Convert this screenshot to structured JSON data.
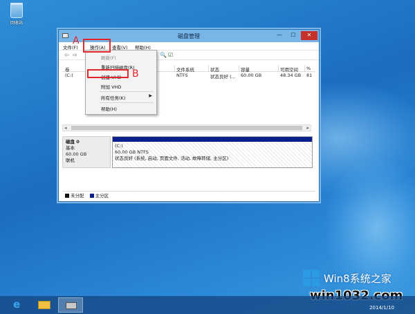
{
  "desktop": {
    "recycle_bin_label": "回收站"
  },
  "window": {
    "title": "磁盘管理",
    "controls": {
      "minimize": "—",
      "maximize": "☐",
      "close": "✕"
    }
  },
  "menubar": {
    "file": "文件(F)",
    "action": "操作(A)",
    "view": "查看(V)",
    "help": "帮助(H)"
  },
  "toolbar": {
    "back": "⇦",
    "forward": "⇨",
    "zoom": "🔍",
    "properties": "☑"
  },
  "volume_list": {
    "columns": {
      "volume": "卷",
      "filesystem": "文件系统",
      "status": "状态",
      "capacity": "容量",
      "free": "可用空间",
      "pct": "%"
    },
    "rows": [
      {
        "volume": "(C:)",
        "filesystem": "NTFS",
        "status": "状态良好 (...",
        "capacity": "60.00 GB",
        "free": "48.34 GB",
        "pct": "81"
      }
    ]
  },
  "disk": {
    "name": "磁盘 0",
    "type": "基本",
    "size": "60.00 GB",
    "state": "联机",
    "partition": {
      "label": "(C:)",
      "size_fs": "60.00 GB NTFS",
      "status": "状态良好 (系统, 启动, 页面文件, 活动, 故障转储, 主分区)"
    }
  },
  "legend": {
    "unallocated": "未分配",
    "primary": "主分区"
  },
  "action_menu": {
    "refresh": "刷新(F)",
    "rescan": "重新扫描磁盘(R)",
    "create_vhd": "创建 VHD",
    "attach_vhd": "附加 VHD",
    "all_tasks": "所有任务(K)",
    "all_tasks_arrow": "▶",
    "help": "帮助(H)"
  },
  "callouts": {
    "a": "A",
    "b": "B"
  },
  "taskbar": {
    "ie_glyph": "e",
    "date": "2014/1/10"
  },
  "watermark": {
    "title": "Win8系统之家",
    "site": "win1032.com"
  },
  "colors": {
    "accent_red": "#e8242b",
    "partition_bar": "#0b1f8c",
    "titlebar": "#78b6e8"
  }
}
